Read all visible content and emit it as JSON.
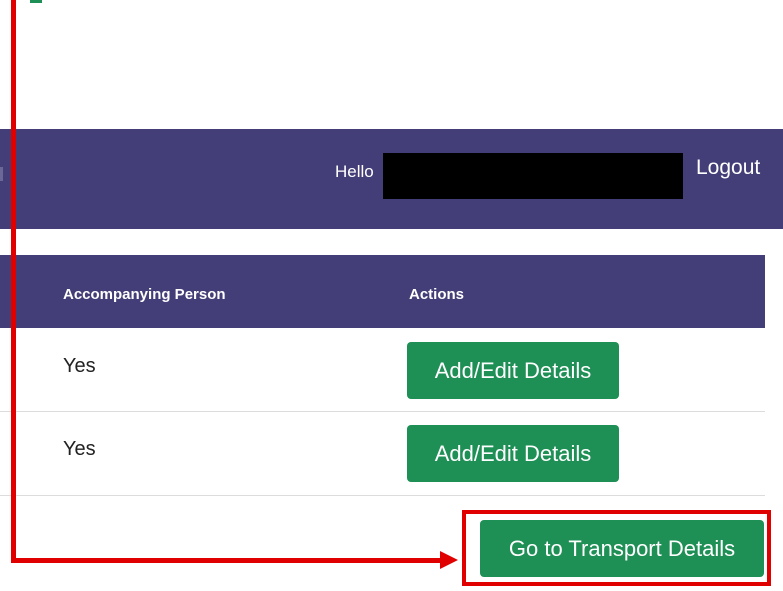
{
  "header": {
    "greeting": "Hello",
    "logout_label": "Logout"
  },
  "table": {
    "columns": [
      "Accompanying Person",
      "Actions"
    ],
    "rows": [
      {
        "accompanying_person": "Yes",
        "action_label": "Add/Edit Details"
      },
      {
        "accompanying_person": "Yes",
        "action_label": "Add/Edit Details"
      }
    ]
  },
  "footer": {
    "transport_button_label": "Go to Transport Details"
  },
  "colors": {
    "navbar": "#433e77",
    "button": "#1e8f55",
    "annotation": "#e00000"
  }
}
